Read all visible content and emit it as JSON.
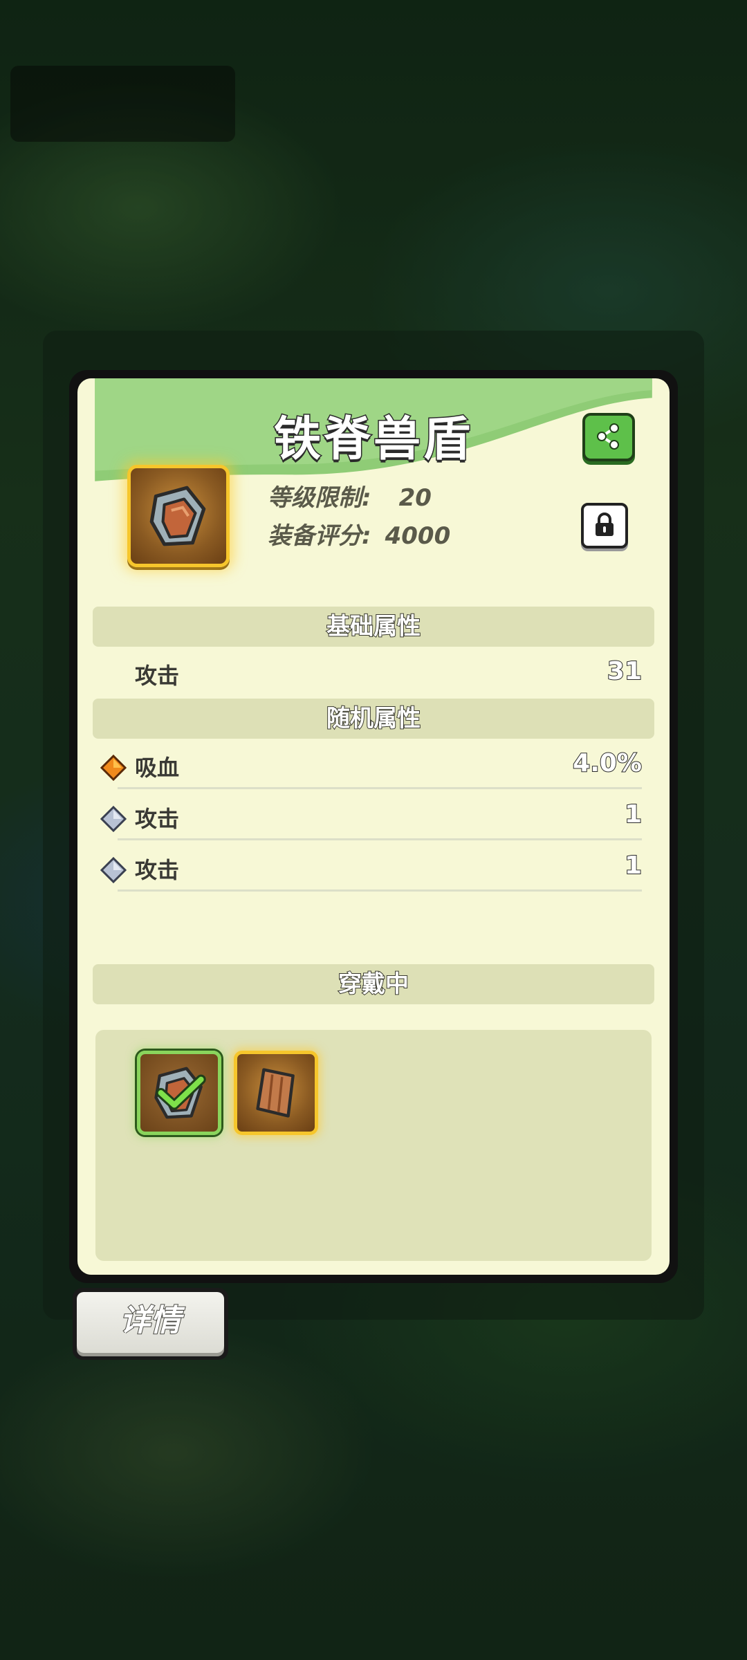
{
  "item": {
    "name": "铁脊兽盾",
    "level_label": "等级限制:",
    "level_value": "20",
    "score_label": "装备评分:",
    "score_value": "4000",
    "icon": "shield-icon"
  },
  "sections": {
    "base": "基础属性",
    "random": "随机属性",
    "wearing": "穿戴中"
  },
  "base_stats": [
    {
      "label": "攻击",
      "value": "31"
    }
  ],
  "random_stats": [
    {
      "label": "吸血",
      "value": "4.0%",
      "gem": "orange-gem-icon"
    },
    {
      "label": "攻击",
      "value": "1",
      "gem": "silver-gem-icon"
    },
    {
      "label": "攻击",
      "value": "1",
      "gem": "silver-gem-icon"
    }
  ],
  "buttons": {
    "detail": "详情"
  },
  "colors": {
    "panel_bg": "#f7f8d6",
    "header_green": "#8fcc76",
    "frame_gold": "#f6c62c",
    "equipped_green": "#8ad45c"
  }
}
